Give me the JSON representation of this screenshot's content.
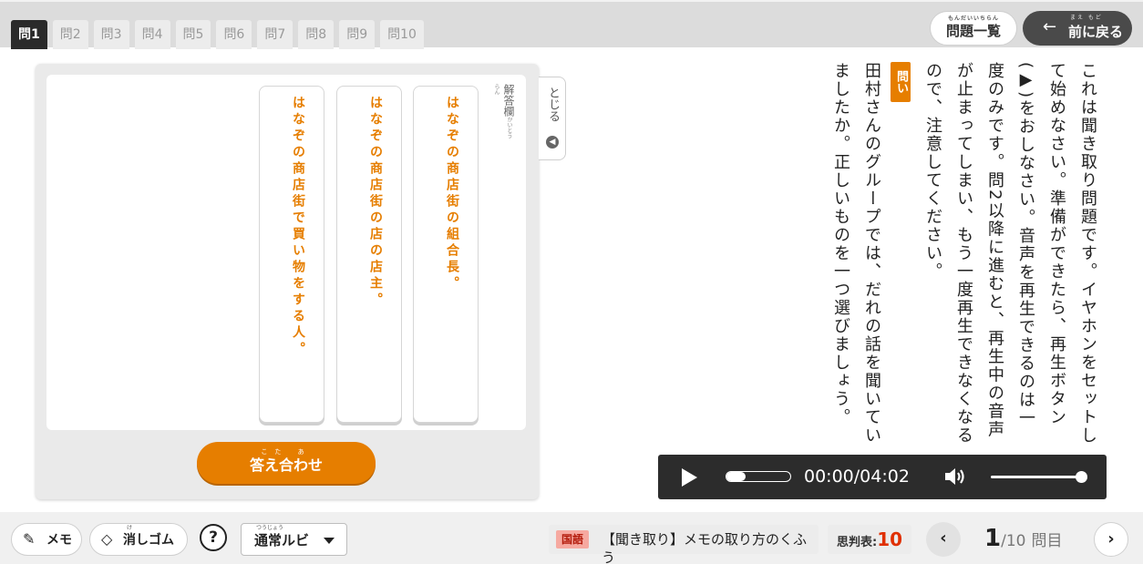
{
  "tabs": [
    {
      "label": "問1",
      "active": true
    },
    {
      "label": "問2",
      "active": false
    },
    {
      "label": "問3",
      "active": false
    },
    {
      "label": "問4",
      "active": false
    },
    {
      "label": "問5",
      "active": false
    },
    {
      "label": "問6",
      "active": false
    },
    {
      "label": "問7",
      "active": false
    },
    {
      "label": "問8",
      "active": false
    },
    {
      "label": "問9",
      "active": false
    },
    {
      "label": "問10",
      "active": false
    }
  ],
  "header": {
    "list_ruby": "もんだいいちらん",
    "list_label": "問題一覧",
    "back_ruby": "まえ もど",
    "back_label": "前に戻る",
    "back_arrow": "←"
  },
  "answer_panel": {
    "heading_ruby": "かいとうらん",
    "heading": "解答欄",
    "choices": [
      "はなぞの商店街の組合長。",
      "はなぞの商店街の店の店主。",
      "はなぞの商店街で買い物をする人。"
    ],
    "check_ruby": "こた あ",
    "check_label": "答え合わせ",
    "close_label": "とじる"
  },
  "instructions": "これは聞き取り問題です。イヤホンをセットして始めなさい。準備ができたら、再生ボタン(▶)をおしなさい。音声を再生できるのは一度のみです。問2以降に進むと、再生中の音声が止まってしまい、もう一度再生できなくなるので、注意してください。",
  "question": {
    "badge": "問い",
    "text": "田村さんのグループでは、だれの話を聞いていましたか。正しいものを一つ選びましょう。"
  },
  "player": {
    "time": "00:00/04:02",
    "progress": 0.0,
    "volume": 1.0
  },
  "footer": {
    "memo_label": "メモ",
    "eraser_ruby": "け",
    "eraser_label": "消しゴム",
    "help_label": "?",
    "ruby_mode_ruby": "つうじょう",
    "ruby_mode_label": "通常ルビ",
    "subject": "国語",
    "lesson_title": "【聞き取り】メモの取り方のくふう",
    "shihan_label": "思判表:",
    "shihan_value": "10",
    "current_page": "1",
    "total_pages": "/10",
    "page_unit": "問目"
  },
  "colors": {
    "accent": "#e67e00",
    "dark": "#2c2c2c",
    "highlight_red": "#e03000"
  }
}
